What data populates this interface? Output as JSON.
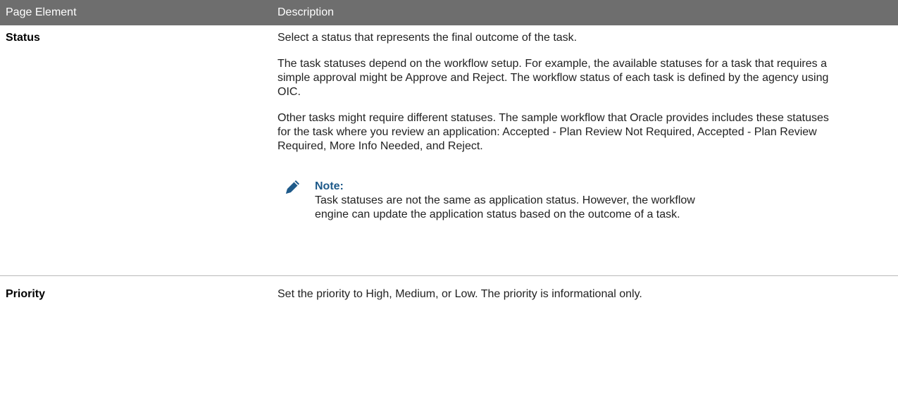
{
  "header": {
    "col1": "Page Element",
    "col2": "Description"
  },
  "rows": [
    {
      "term": "Status",
      "paragraphs": [
        "Select a status that represents the final outcome of the task.",
        "The task statuses depend on the workflow setup. For example, the available statuses for a task that requires a simple approval might be Approve and Reject. The workflow status of each task is defined by the agency using OIC.",
        "Other tasks might require different statuses. The sample workflow that Oracle provides includes these statuses for the task where you review an application: Accepted - Plan Review Not Required, Accepted - Plan Review Required, More Info Needed, and Reject."
      ],
      "note": {
        "icon": "pencil-icon",
        "title": "Note:",
        "text": "Task statuses are not the same as application status. However, the workflow engine can update the application status based on the outcome of a task."
      }
    },
    {
      "term": "Priority",
      "paragraphs": [
        "Set the priority to High, Medium, or Low. The priority is informational only."
      ]
    }
  ],
  "colors": {
    "header_bg": "#6e6e6e",
    "header_text": "#ffffff",
    "note_accent": "#1e5a8a"
  }
}
